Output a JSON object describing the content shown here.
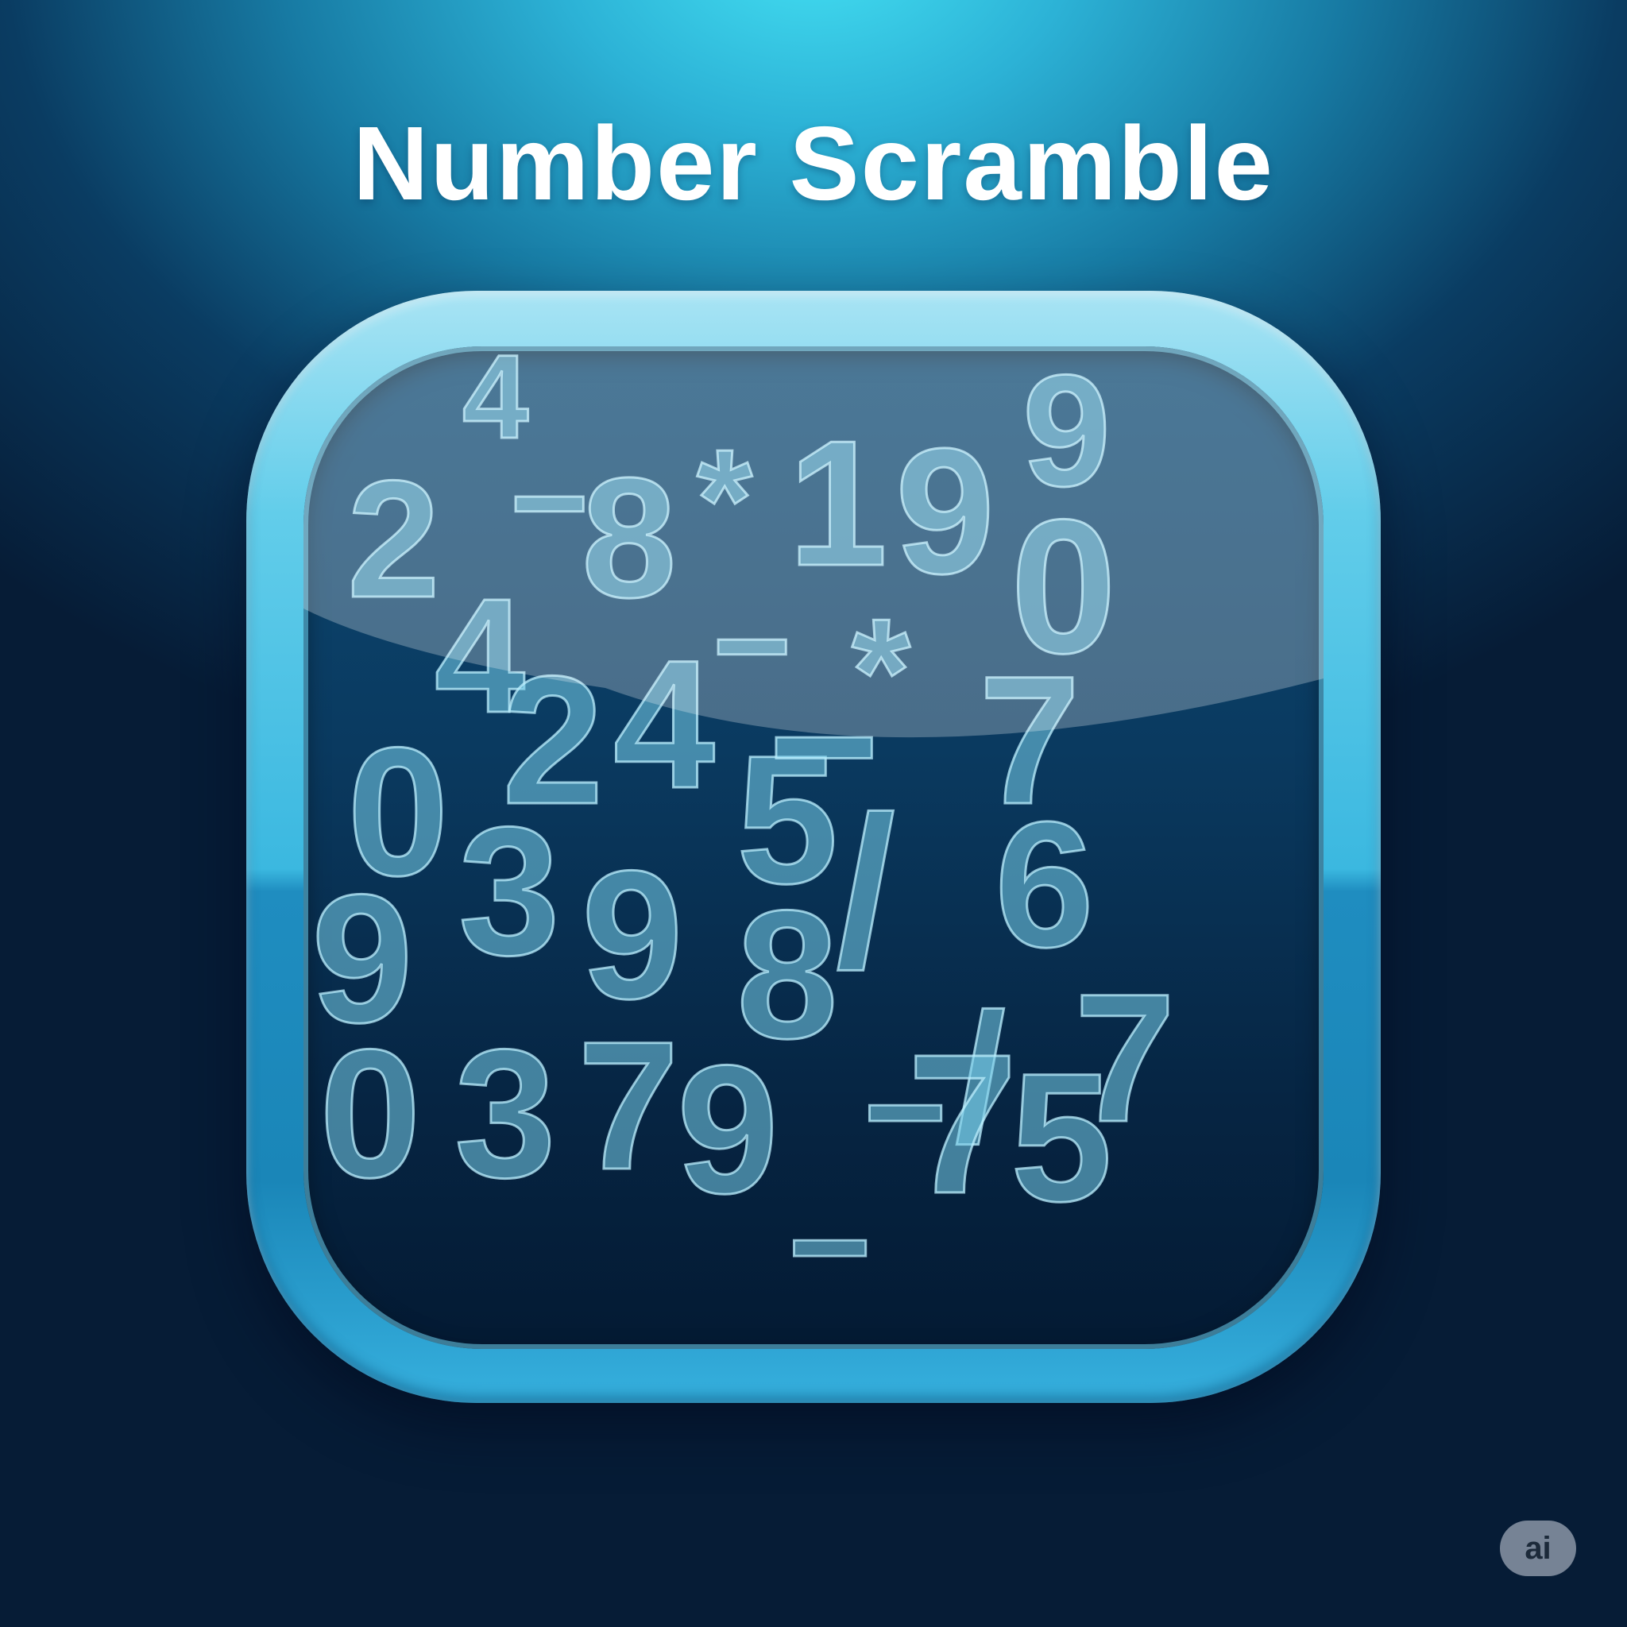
{
  "title": "Number Scramble",
  "badge": "ai",
  "tiles": [
    {
      "char": "4"
    },
    {
      "char": "2"
    },
    {
      "char": "−"
    },
    {
      "char": "8"
    },
    {
      "char": "*"
    },
    {
      "char": "1"
    },
    {
      "char": "9"
    },
    {
      "char": "9"
    },
    {
      "char": "4"
    },
    {
      "char": "0"
    },
    {
      "char": "−"
    },
    {
      "char": "*"
    },
    {
      "char": "2"
    },
    {
      "char": "4"
    },
    {
      "char": "0"
    },
    {
      "char": "5"
    },
    {
      "char": "−"
    },
    {
      "char": "7"
    },
    {
      "char": "3"
    },
    {
      "char": "9"
    },
    {
      "char": "/"
    },
    {
      "char": "6"
    },
    {
      "char": "9"
    },
    {
      "char": "8"
    },
    {
      "char": "−"
    },
    {
      "char": "/"
    },
    {
      "char": "0"
    },
    {
      "char": "3"
    },
    {
      "char": "7"
    },
    {
      "char": "9"
    },
    {
      "char": "−"
    },
    {
      "char": "7"
    },
    {
      "char": "5"
    },
    {
      "char": "7"
    }
  ],
  "colors": {
    "background_top": "#45e2f4",
    "background_bottom": "#061c36",
    "frame": "#3bb8e0",
    "screen": "#062543",
    "glyph_fill": "#76ceea",
    "title": "#ffffff"
  }
}
